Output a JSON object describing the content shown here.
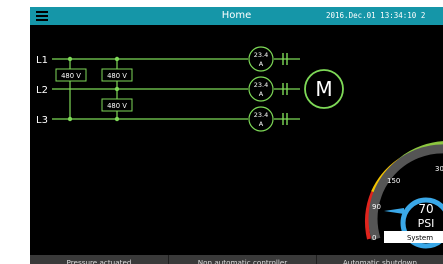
{
  "header": {
    "title": "Home",
    "datetime": "2016.Dec.01  13:34:10  2"
  },
  "lines": [
    "L1",
    "L2",
    "L3"
  ],
  "transformers": [
    "480 V",
    "480 V",
    "480 V"
  ],
  "meters": [
    {
      "value": "23.4",
      "unit": "A"
    },
    {
      "value": "23.4",
      "unit": "A"
    },
    {
      "value": "23.4",
      "unit": "A"
    }
  ],
  "motor": {
    "label": "M"
  },
  "gauge": {
    "value": "70",
    "unit": "PSI",
    "level": 70,
    "ticks": [
      "0",
      "90",
      "150",
      "30"
    ],
    "source": "System",
    "colors": {
      "normal": "#3aa8e8",
      "warn": "#8cc63f",
      "caution": "#f3c300",
      "alarm": "#e0241d"
    }
  },
  "footer": {
    "buttons": [
      "Pressure actuated",
      "Non automatic controller",
      "Automatic shutdown"
    ]
  },
  "colors": {
    "accent": "#1596a8",
    "wire": "#7ed957"
  }
}
